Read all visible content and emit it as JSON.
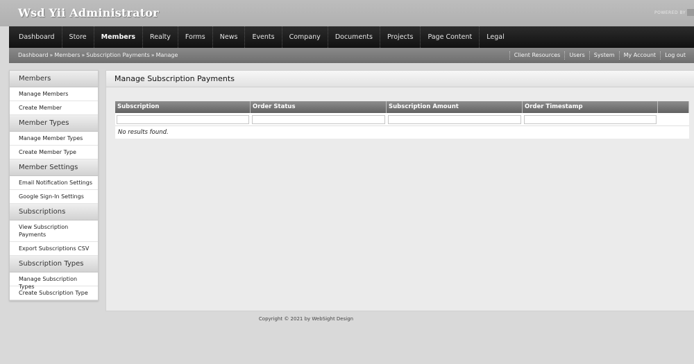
{
  "header": {
    "site_title": "Wsd Yii Administrator",
    "powered_by": "POWERED BY"
  },
  "main_menu": [
    {
      "label": "Dashboard",
      "active": false
    },
    {
      "label": "Store",
      "active": false
    },
    {
      "label": "Members",
      "active": true
    },
    {
      "label": "Realty",
      "active": false
    },
    {
      "label": "Forms",
      "active": false
    },
    {
      "label": "News",
      "active": false
    },
    {
      "label": "Events",
      "active": false
    },
    {
      "label": "Company",
      "active": false
    },
    {
      "label": "Documents",
      "active": false
    },
    {
      "label": "Projects",
      "active": false
    },
    {
      "label": "Page Content",
      "active": false
    },
    {
      "label": "Legal",
      "active": false
    }
  ],
  "breadcrumb": {
    "items": [
      "Dashboard",
      "Members",
      "Subscription Payments",
      "Manage"
    ],
    "separator": "»"
  },
  "utility_links": [
    "Client Resources",
    "Users",
    "System",
    "My Account",
    "Log out"
  ],
  "sidebar": {
    "sections": [
      {
        "heading": "Members",
        "links": [
          "Manage Members",
          "Create Member"
        ]
      },
      {
        "heading": "Member Types",
        "links": [
          "Manage Member Types",
          "Create Member Type"
        ]
      },
      {
        "heading": "Member Settings",
        "links": [
          "Email Notification Settings",
          "Google Sign-In Settings"
        ]
      },
      {
        "heading": "Subscriptions",
        "links": [
          "View Subscription Payments",
          "Export Subscriptions CSV"
        ]
      },
      {
        "heading": "Subscription Types",
        "links": [
          "Manage Subscription Types",
          "Create Subscription Type"
        ]
      }
    ]
  },
  "content": {
    "title": "Manage Subscription Payments",
    "grid": {
      "columns": [
        "Subscription",
        "Order Status",
        "Subscription Amount",
        "Order Timestamp",
        ""
      ],
      "filters": [
        "",
        "",
        "",
        ""
      ],
      "empty_text": "No results found."
    }
  },
  "footer": {
    "copyright": "Copyright © 2021 by WebSight Design"
  },
  "colors": {
    "menu_bar": "#1a1a1a",
    "sub_bar": "#7a7a7a",
    "grid_header": "#6e6e6e",
    "page_background": "#d9d9d9"
  }
}
